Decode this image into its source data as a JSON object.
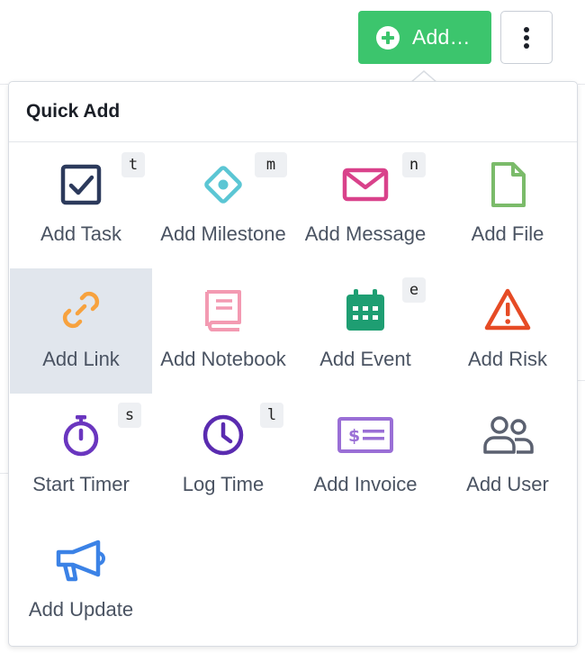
{
  "toolbar": {
    "add_label": "Add…",
    "accent": "#3cc56d"
  },
  "popover": {
    "title": "Quick Add",
    "items": [
      {
        "label": "Add Task",
        "icon": "checkbox-icon",
        "color": "#2c3a5c",
        "shortcut": "t"
      },
      {
        "label": "Add Milestone",
        "icon": "milestone-diamond-icon",
        "color": "#5bc6d4",
        "shortcut": "m"
      },
      {
        "label": "Add Message",
        "icon": "envelope-icon",
        "color": "#d9428b",
        "shortcut": "n"
      },
      {
        "label": "Add File",
        "icon": "file-icon",
        "color": "#7bbb6a",
        "shortcut": ""
      },
      {
        "label": "Add Link",
        "icon": "link-icon",
        "color": "#f7a23e",
        "shortcut": ""
      },
      {
        "label": "Add Notebook",
        "icon": "notebook-icon",
        "color": "#f39ab2",
        "shortcut": ""
      },
      {
        "label": "Add Event",
        "icon": "calendar-icon",
        "color": "#1e9e72",
        "shortcut": "e"
      },
      {
        "label": "Add Risk",
        "icon": "warning-icon",
        "color": "#e64b25",
        "shortcut": ""
      },
      {
        "label": "Start Timer",
        "icon": "stopwatch-icon",
        "color": "#6a36bf",
        "shortcut": "s"
      },
      {
        "label": "Log Time",
        "icon": "clock-icon",
        "color": "#5a2bb0",
        "shortcut": "l"
      },
      {
        "label": "Add Invoice",
        "icon": "invoice-icon",
        "color": "#9a6fd6",
        "shortcut": ""
      },
      {
        "label": "Add User",
        "icon": "users-icon",
        "color": "#5b6170",
        "shortcut": ""
      },
      {
        "label": "Add Update",
        "icon": "megaphone-icon",
        "color": "#3b82e6",
        "shortcut": ""
      }
    ]
  }
}
